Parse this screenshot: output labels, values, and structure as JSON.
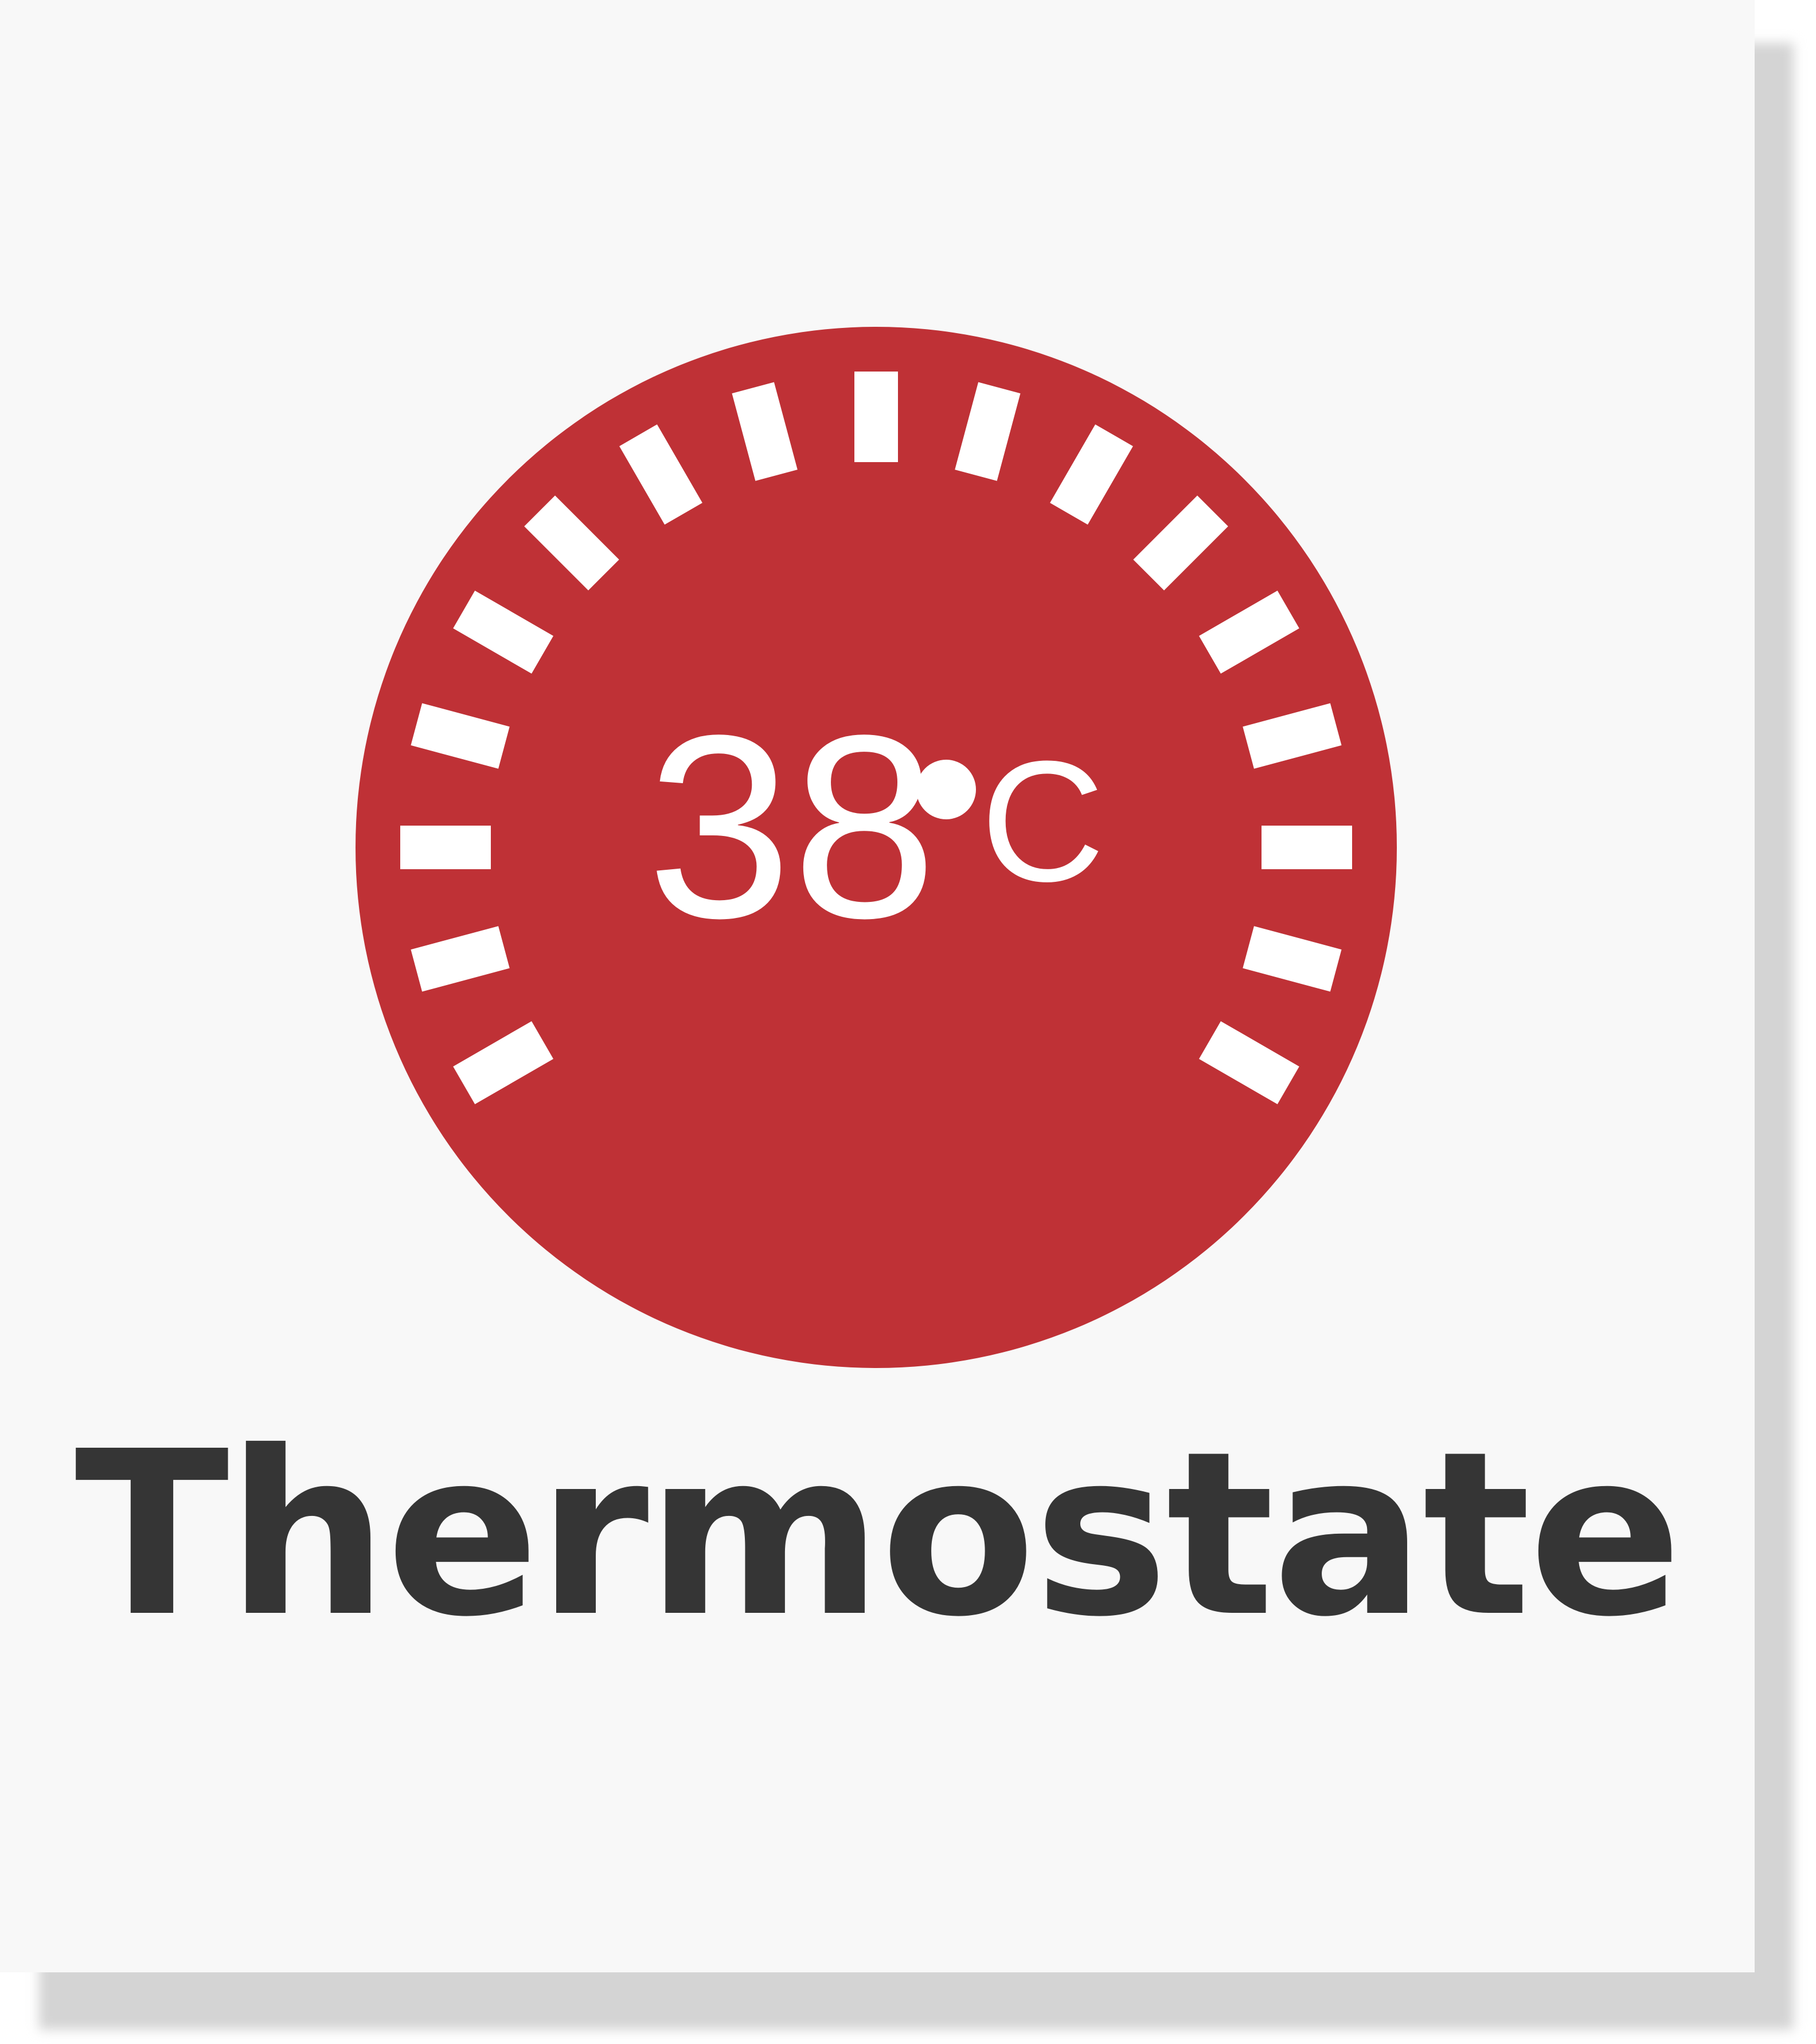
{
  "thermostat": {
    "temperature_value": "38",
    "temperature_unit": "C",
    "label": "Thermostate",
    "dial_tick_count": 17
  },
  "colors": {
    "dial": "#bf3136",
    "ticks": "#ffffff",
    "label": "#353535",
    "card": "#f8f8f8"
  },
  "icons": {
    "dial": "thermostat-dial-icon",
    "degree": "degree-dot-icon"
  }
}
